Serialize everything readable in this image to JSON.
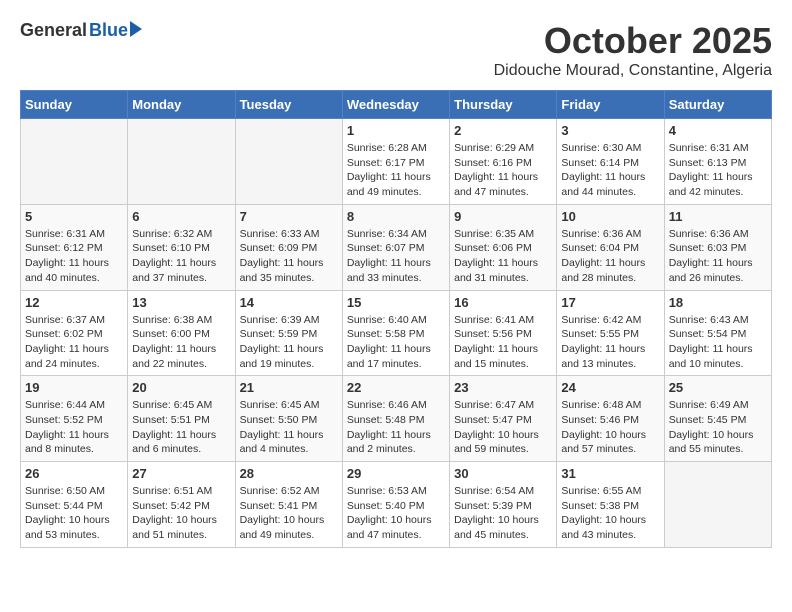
{
  "header": {
    "logo_general": "General",
    "logo_blue": "Blue",
    "month_title": "October 2025",
    "location": "Didouche Mourad, Constantine, Algeria"
  },
  "weekdays": [
    "Sunday",
    "Monday",
    "Tuesday",
    "Wednesday",
    "Thursday",
    "Friday",
    "Saturday"
  ],
  "weeks": [
    [
      {
        "day": "",
        "empty": true
      },
      {
        "day": "",
        "empty": true
      },
      {
        "day": "",
        "empty": true
      },
      {
        "day": "1",
        "info": "Sunrise: 6:28 AM\nSunset: 6:17 PM\nDaylight: 11 hours\nand 49 minutes."
      },
      {
        "day": "2",
        "info": "Sunrise: 6:29 AM\nSunset: 6:16 PM\nDaylight: 11 hours\nand 47 minutes."
      },
      {
        "day": "3",
        "info": "Sunrise: 6:30 AM\nSunset: 6:14 PM\nDaylight: 11 hours\nand 44 minutes."
      },
      {
        "day": "4",
        "info": "Sunrise: 6:31 AM\nSunset: 6:13 PM\nDaylight: 11 hours\nand 42 minutes."
      }
    ],
    [
      {
        "day": "5",
        "info": "Sunrise: 6:31 AM\nSunset: 6:12 PM\nDaylight: 11 hours\nand 40 minutes."
      },
      {
        "day": "6",
        "info": "Sunrise: 6:32 AM\nSunset: 6:10 PM\nDaylight: 11 hours\nand 37 minutes."
      },
      {
        "day": "7",
        "info": "Sunrise: 6:33 AM\nSunset: 6:09 PM\nDaylight: 11 hours\nand 35 minutes."
      },
      {
        "day": "8",
        "info": "Sunrise: 6:34 AM\nSunset: 6:07 PM\nDaylight: 11 hours\nand 33 minutes."
      },
      {
        "day": "9",
        "info": "Sunrise: 6:35 AM\nSunset: 6:06 PM\nDaylight: 11 hours\nand 31 minutes."
      },
      {
        "day": "10",
        "info": "Sunrise: 6:36 AM\nSunset: 6:04 PM\nDaylight: 11 hours\nand 28 minutes."
      },
      {
        "day": "11",
        "info": "Sunrise: 6:36 AM\nSunset: 6:03 PM\nDaylight: 11 hours\nand 26 minutes."
      }
    ],
    [
      {
        "day": "12",
        "info": "Sunrise: 6:37 AM\nSunset: 6:02 PM\nDaylight: 11 hours\nand 24 minutes."
      },
      {
        "day": "13",
        "info": "Sunrise: 6:38 AM\nSunset: 6:00 PM\nDaylight: 11 hours\nand 22 minutes."
      },
      {
        "day": "14",
        "info": "Sunrise: 6:39 AM\nSunset: 5:59 PM\nDaylight: 11 hours\nand 19 minutes."
      },
      {
        "day": "15",
        "info": "Sunrise: 6:40 AM\nSunset: 5:58 PM\nDaylight: 11 hours\nand 17 minutes."
      },
      {
        "day": "16",
        "info": "Sunrise: 6:41 AM\nSunset: 5:56 PM\nDaylight: 11 hours\nand 15 minutes."
      },
      {
        "day": "17",
        "info": "Sunrise: 6:42 AM\nSunset: 5:55 PM\nDaylight: 11 hours\nand 13 minutes."
      },
      {
        "day": "18",
        "info": "Sunrise: 6:43 AM\nSunset: 5:54 PM\nDaylight: 11 hours\nand 10 minutes."
      }
    ],
    [
      {
        "day": "19",
        "info": "Sunrise: 6:44 AM\nSunset: 5:52 PM\nDaylight: 11 hours\nand 8 minutes."
      },
      {
        "day": "20",
        "info": "Sunrise: 6:45 AM\nSunset: 5:51 PM\nDaylight: 11 hours\nand 6 minutes."
      },
      {
        "day": "21",
        "info": "Sunrise: 6:45 AM\nSunset: 5:50 PM\nDaylight: 11 hours\nand 4 minutes."
      },
      {
        "day": "22",
        "info": "Sunrise: 6:46 AM\nSunset: 5:48 PM\nDaylight: 11 hours\nand 2 minutes."
      },
      {
        "day": "23",
        "info": "Sunrise: 6:47 AM\nSunset: 5:47 PM\nDaylight: 10 hours\nand 59 minutes."
      },
      {
        "day": "24",
        "info": "Sunrise: 6:48 AM\nSunset: 5:46 PM\nDaylight: 10 hours\nand 57 minutes."
      },
      {
        "day": "25",
        "info": "Sunrise: 6:49 AM\nSunset: 5:45 PM\nDaylight: 10 hours\nand 55 minutes."
      }
    ],
    [
      {
        "day": "26",
        "info": "Sunrise: 6:50 AM\nSunset: 5:44 PM\nDaylight: 10 hours\nand 53 minutes."
      },
      {
        "day": "27",
        "info": "Sunrise: 6:51 AM\nSunset: 5:42 PM\nDaylight: 10 hours\nand 51 minutes."
      },
      {
        "day": "28",
        "info": "Sunrise: 6:52 AM\nSunset: 5:41 PM\nDaylight: 10 hours\nand 49 minutes."
      },
      {
        "day": "29",
        "info": "Sunrise: 6:53 AM\nSunset: 5:40 PM\nDaylight: 10 hours\nand 47 minutes."
      },
      {
        "day": "30",
        "info": "Sunrise: 6:54 AM\nSunset: 5:39 PM\nDaylight: 10 hours\nand 45 minutes."
      },
      {
        "day": "31",
        "info": "Sunrise: 6:55 AM\nSunset: 5:38 PM\nDaylight: 10 hours\nand 43 minutes."
      },
      {
        "day": "",
        "empty": true
      }
    ]
  ]
}
